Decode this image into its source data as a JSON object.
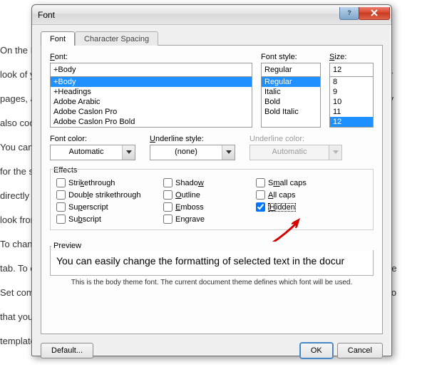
{
  "background": {
    "p1": "On the Insert tab, the galleries include items that are designed to coordinate the overall",
    "p2": "look of your document. You can use these galleries to insert tables, headers, footers, lists, cover",
    "p3": "pages, and other document building blocks. When you create pictures, charts, or diagrams, they",
    "p4": "also coordinate with your current document look.",
    "p5": "You can easily change the formatting of selected text in the document text by choosing a look",
    "p6": "for the selected text from the Quick Styles gallery on the Home tab. You can also format text",
    "p7": "directly by using the other controls on the Home tab. Most controls offer a choice of using the",
    "p8": "look from the current theme or using a format that you specify directly.",
    "p9": "To change the overall look of your document, choose new Theme elements on the Page Layout",
    "p10": "tab. To change the looks available in the Quick Style gallery, use the Change Current Quick Style",
    "p11": "Set command. Both the Themes gallery and the Quick Styles gallery provide reset commands so",
    "p12": "that you can always restore the look of your document to the original contained in your current",
    "p13": "template."
  },
  "dialog": {
    "title": "Font",
    "tabs": {
      "font": "Font",
      "spacing": "Character Spacing"
    },
    "labels": {
      "font": "Font:",
      "font_style": "Font style:",
      "size": "Size:",
      "font_color": "Font color:",
      "underline_style": "Underline style:",
      "underline_color": "Underline color:",
      "effects": "Effects",
      "preview": "Preview"
    },
    "font": {
      "value": "+Body",
      "items": [
        "+Body",
        "+Headings",
        "Adobe Arabic",
        "Adobe Caslon Pro",
        "Adobe Caslon Pro Bold"
      ],
      "selected": "+Body"
    },
    "font_style": {
      "value": "Regular",
      "items": [
        "Regular",
        "Italic",
        "Bold",
        "Bold Italic"
      ],
      "selected": "Regular"
    },
    "size": {
      "value": "12",
      "items": [
        "8",
        "9",
        "10",
        "11",
        "12"
      ],
      "selected": "12"
    },
    "font_color": {
      "value": "Automatic"
    },
    "underline_style": {
      "value": "(none)"
    },
    "underline_color": {
      "value": "Automatic"
    },
    "effects": {
      "strikethrough": "Strikethrough",
      "double_strikethrough": "Double strikethrough",
      "superscript": "Superscript",
      "subscript": "Subscript",
      "shadow": "Shadow",
      "outline": "Outline",
      "emboss": "Emboss",
      "engrave": "Engrave",
      "small_caps": "Small caps",
      "all_caps": "All caps",
      "hidden": "Hidden"
    },
    "preview_text": "You can easily change the formatting of selected text in the docur",
    "preview_note": "This is the body theme font. The current document theme defines which font will be used.",
    "buttons": {
      "default": "Default...",
      "ok": "OK",
      "cancel": "Cancel"
    }
  }
}
